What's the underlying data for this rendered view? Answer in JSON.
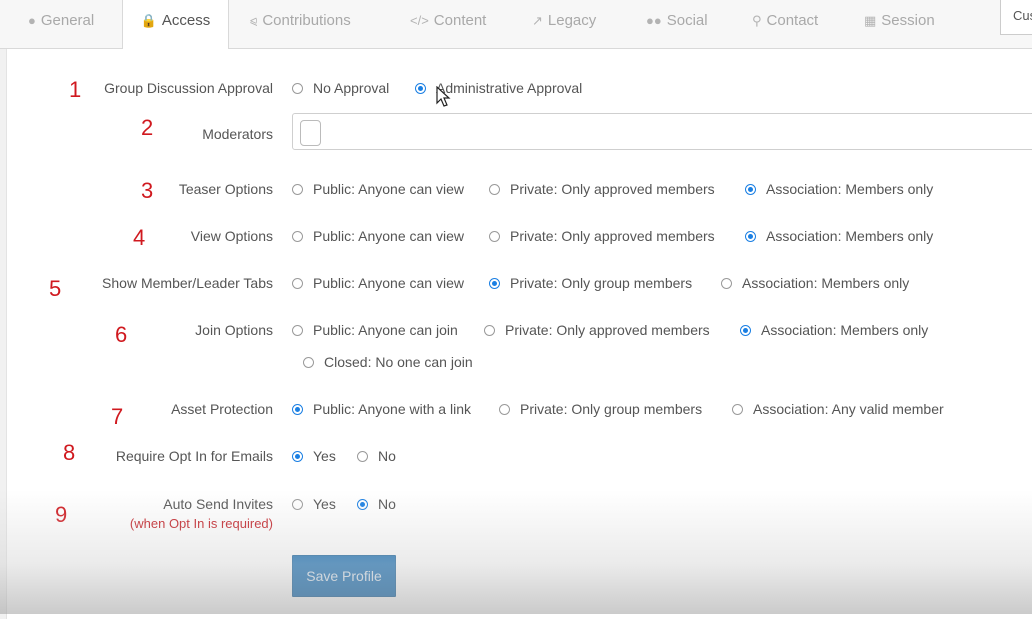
{
  "tabs": [
    {
      "label": "General",
      "icon": "user-icon",
      "active": false
    },
    {
      "label": "Access",
      "icon": "lock-icon",
      "active": true
    },
    {
      "label": "Contributions",
      "icon": "share-icon",
      "active": false
    },
    {
      "label": "Content",
      "icon": "code-icon",
      "active": false
    },
    {
      "label": "Legacy",
      "icon": "external-link-icon",
      "active": false
    },
    {
      "label": "Social",
      "icon": "users-icon",
      "active": false
    },
    {
      "label": "Contact",
      "icon": "map-marker-icon",
      "active": false
    },
    {
      "label": "Session",
      "icon": "calendar-icon",
      "active": false
    }
  ],
  "corner_button": "Cus",
  "annotations": [
    "1",
    "2",
    "3",
    "4",
    "5",
    "6",
    "7",
    "8",
    "9"
  ],
  "fields": {
    "group_discussion": {
      "label": "Group Discussion Approval",
      "options": [
        "No Approval",
        "Administrative Approval"
      ],
      "selected": 1
    },
    "moderators": {
      "label": "Moderators",
      "value": ""
    },
    "teaser": {
      "label": "Teaser Options",
      "options": [
        "Public: Anyone can view",
        "Private: Only approved members",
        "Association: Members only"
      ],
      "selected": 2
    },
    "view": {
      "label": "View Options",
      "options": [
        "Public: Anyone can view",
        "Private: Only approved members",
        "Association: Members only"
      ],
      "selected": 2
    },
    "member_tabs": {
      "label": "Show Member/Leader Tabs",
      "options": [
        "Public: Anyone can view",
        "Private: Only group members",
        "Association: Members only"
      ],
      "selected": 1
    },
    "join": {
      "label": "Join Options",
      "options": [
        "Public: Anyone can join",
        "Private: Only approved members",
        "Association: Members only",
        "Closed: No one can join"
      ],
      "selected": 2
    },
    "asset": {
      "label": "Asset Protection",
      "options": [
        "Public: Anyone with a link",
        "Private: Only group members",
        "Association: Any valid member"
      ],
      "selected": 0
    },
    "opt_in": {
      "label": "Require Opt In for Emails",
      "options": [
        "Yes",
        "No"
      ],
      "selected": 0
    },
    "auto_send": {
      "label": "Auto Send Invites",
      "sublabel": "(when Opt In is required)",
      "options": [
        "Yes",
        "No"
      ],
      "selected": 1
    }
  },
  "save_button": "Save Profile",
  "colors": {
    "accent": "#1a7fe3",
    "save_bg": "#0b66ae",
    "annotation": "#d0191f"
  }
}
